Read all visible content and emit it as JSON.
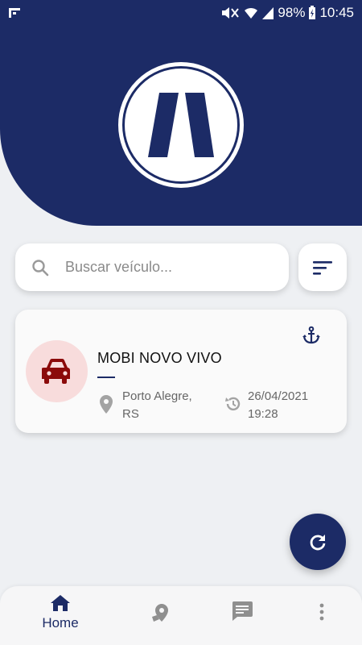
{
  "status_bar": {
    "battery": "98%",
    "time": "10:45"
  },
  "logo": {
    "name": "m-logo"
  },
  "search": {
    "placeholder": "Buscar veículo..."
  },
  "vehicles": [
    {
      "name": "MOBI NOVO VIVO",
      "location": "Porto Alegre, RS",
      "date": "26/04/2021",
      "time": "19:28"
    }
  ],
  "bottom_nav": {
    "home_label": "Home"
  },
  "colors": {
    "primary": "#1c2b66",
    "car_bg": "#f8dcdc",
    "car_icon": "#8b0a0a",
    "background": "#eef0f3"
  }
}
